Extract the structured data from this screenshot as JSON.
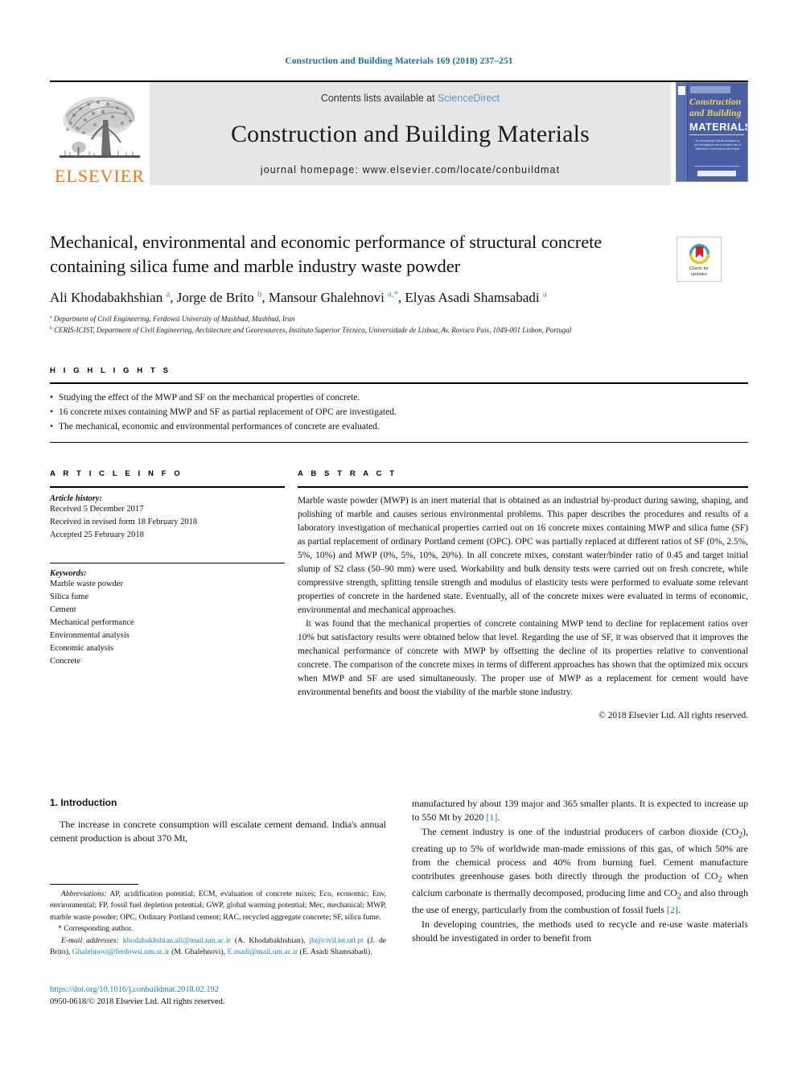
{
  "running_head": "Construction and Building Materials 169 (2018) 237–251",
  "masthead": {
    "publisher_logo_label": "ELSEVIER",
    "contents_prefix": "Contents lists available at ",
    "contents_link": "ScienceDirect",
    "journal_title": "Construction and Building Materials",
    "homepage": "journal homepage: www.elsevier.com/locate/conbuildmat",
    "cover": {
      "line1": "Construction",
      "line2": "and Building",
      "line3": "MATERIALS",
      "blurb": "An International Journal dedicated to the Investigation and Innovative use of Materials in Construction and Repair"
    }
  },
  "crossmark": {
    "line1": "Check for",
    "line2": "updates"
  },
  "article": {
    "title": "Mechanical, environmental and economic performance of structural concrete containing silica fume and marble industry waste powder",
    "authors_html": "Ali Khodabakhshian <sup>a</sup>, Jorge de Brito <sup>b</sup>, Mansour Ghalehnovi <sup>a,*</sup>, Elyas Asadi Shamsabadi <sup>a</sup>",
    "affiliations": [
      "Department of Civil Engineering, Ferdowsi University of Mashhad, Mashhad, Iran",
      "CERIS-ICIST, Department of Civil Engineering, Architecture and Georesources, Instituto Superior Técnico, Universidade de Lisboa, Av. Rovisco Pais, 1049-001 Lisbon, Portugal"
    ],
    "affiliation_marks": [
      "a",
      "b"
    ]
  },
  "highlights": {
    "heading": "H I G H L I G H T S",
    "items": [
      "Studying the effect of the MWP and SF on the mechanical properties of concrete.",
      "16 concrete mixes containing MWP and SF as partial replacement of OPC are investigated.",
      "The mechanical, economic and environmental performances of concrete are evaluated."
    ],
    "bullet": "•"
  },
  "article_info": {
    "heading": "A R T I C L E   I N F O",
    "history_label": "Article history:",
    "history": [
      "Received 5 December 2017",
      "Received in revised form 18 February 2018",
      "Accepted 25 February 2018"
    ],
    "keywords_label": "Keywords:",
    "keywords": [
      "Marble waste powder",
      "Silica fume",
      "Cement",
      "Mechanical performance",
      "Environmental analysis",
      "Economic analysis",
      "Concrete"
    ]
  },
  "abstract": {
    "heading": "A B S T R A C T",
    "paragraph_1": "Marble waste powder (MWP) is an inert material that is obtained as an industrial by-product during sawing, shaping, and polishing of marble and causes serious environmental problems. This paper describes the procedures and results of a laboratory investigation of mechanical properties carried out on 16 concrete mixes containing MWP and silica fume (SF) as partial replacement of ordinary Portland cement (OPC). OPC was partially replaced at different ratios of SF (0%, 2.5%, 5%, 10%) and MWP (0%, 5%, 10%, 20%). In all concrete mixes, constant water/binder ratio of 0.45 and target initial slump of S2 class (50–90 mm) were used. Workability and bulk density tests were carried out on fresh concrete, while compressive strength, splitting tensile strength and modulus of elasticity tests were performed to evaluate some relevant properties of concrete in the hardened state. Eventually, all of the concrete mixes were evaluated in terms of economic, environmental and mechanical approaches.",
    "paragraph_2": "It was found that the mechanical properties of concrete containing MWP tend to decline for replacement ratios over 10% but satisfactory results were obtained below that level. Regarding the use of SF, it was observed that it improves the mechanical performance of concrete with MWP by offsetting the decline of its properties relative to conventional concrete. The comparison of the concrete mixes in terms of different approaches has shown that the optimized mix occurs when MWP and SF are used simultaneously. The proper use of MWP as a replacement for cement would have environmental benefits and boost the viability of the marble stone industry.",
    "copyright": "© 2018 Elsevier Ltd. All rights reserved."
  },
  "body": {
    "section_title": "1. Introduction",
    "left_p1": "The increase in concrete consumption will escalate cement demand. India's annual cement production is about 370 Mt,",
    "right_p1_cont": "manufactured by about 139 major and 365 smaller plants. It is expected to increase up to 550 Mt by 2020 ",
    "right_p1_ref": "[1]",
    "right_p2_a": "The cement industry is one of the industrial producers of carbon dioxide (CO",
    "right_p2_sub1": "2",
    "right_p2_b": "), creating up to 5% of worldwide man-made emissions of this gas, of which 50% are from the chemical process and 40% from burning fuel. Cement manufacture contributes greenhouse gases both directly through the production of CO",
    "right_p2_sub2": "2",
    "right_p2_c": " when calcium carbonate is thermally decomposed, producing lime and CO",
    "right_p2_sub3": "2",
    "right_p2_d": " and also through the use of energy, particularly from the combustion of fossil fuels ",
    "right_p2_ref": "[2]",
    "right_p3": "In developing countries, the methods used to recycle and re-use waste materials should be investigated in order to benefit from"
  },
  "footnotes": {
    "abbrev_label": "Abbreviations:",
    "abbrev_text": " AP, acidification potential; ECM, evaluation of concrete mixes; Eco, economic; Env, environmental; FP, fossil fuel depletion potential; GWP, global warming potential; Mec, mechanical; MWP, marble waste powder; OPC, Ordinary Portland cement; RAC, recycled aggregate concrete; SF, silica fume.",
    "corresponding": "* Corresponding author.",
    "email_label": "E-mail addresses:",
    "emails": [
      {
        "address": "khodabakhshian.ali@mail.um.ac.ir",
        "name": "(A. Khodabakhshian),"
      },
      {
        "address": "jb@civil.ist.utl.pt",
        "name": "(J. de Brito),"
      },
      {
        "address": "Ghalehnovi@ferdowsi.um.ac.ir",
        "name": "(M. Ghalehnovi),"
      },
      {
        "address": "E.asadi@mail.um.ac.ir",
        "name": "(E. Asadi Shamsabadi)."
      }
    ]
  },
  "footer": {
    "doi": "https://doi.org/10.1016/j.conbuildmat.2018.02.192",
    "issn": "0950-0618/© 2018 Elsevier Ltd. All rights reserved."
  },
  "colors": {
    "link_blue": "#1a7fbf",
    "header_blue": "#1a6fa3",
    "elsevier_orange": "#E87722",
    "masthead_grey": "#e6e6e6",
    "cover_blue": "#4a5fa5",
    "cover_yellow": "#f3d54e"
  }
}
